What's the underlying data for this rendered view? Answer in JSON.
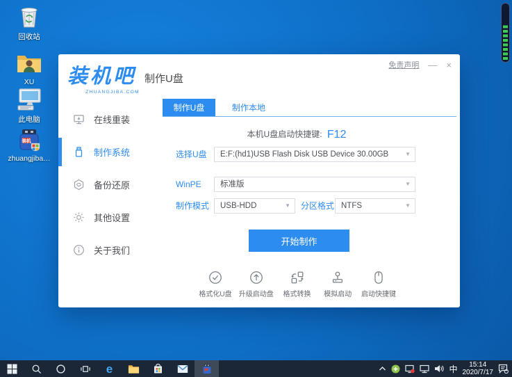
{
  "desktop": {
    "icons": [
      {
        "label": "回收站"
      },
      {
        "label": "XU"
      },
      {
        "label": "此电脑"
      },
      {
        "label": "zhuangjiba…"
      }
    ]
  },
  "app": {
    "logo": {
      "title": "装机吧",
      "subtitle": "ZHUANGJIBA.COM"
    },
    "title": "制作U盘",
    "titlebar": {
      "disclaimer": "免责声明",
      "minimize": "—",
      "close": "×"
    },
    "sidebar": [
      {
        "label": "在线重装"
      },
      {
        "label": "制作系统"
      },
      {
        "label": "备份还原"
      },
      {
        "label": "其他设置"
      },
      {
        "label": "关于我们"
      }
    ],
    "tabs": [
      {
        "label": "制作U盘"
      },
      {
        "label": "制作本地"
      }
    ],
    "hotkey": {
      "label": "本机U盘启动快捷键:",
      "value": "F12"
    },
    "form": {
      "usb": {
        "label": "选择U盘",
        "value": "E:F:(hd1)USB Flash Disk USB Device 30.00GB"
      },
      "winpe": {
        "label": "WinPE",
        "value": "标准版"
      },
      "mode": {
        "label": "制作模式",
        "value": "USB-HDD"
      },
      "partition": {
        "label": "分区格式",
        "value": "NTFS"
      }
    },
    "start_button": "开始制作",
    "tools": [
      {
        "label": "格式化U盘"
      },
      {
        "label": "升级启动盘"
      },
      {
        "label": "格式转换"
      },
      {
        "label": "模拟启动"
      },
      {
        "label": "启动快捷键"
      }
    ]
  },
  "taskbar": {
    "ime": "中",
    "time": "15:14",
    "date": "2020/7/17"
  },
  "colors": {
    "accent": "#2d8cf0",
    "taskbar": "#1b2737",
    "desktop_top": "#1583e0",
    "desktop_bottom": "#0a58a6",
    "meter_green": "#3ecb54"
  }
}
